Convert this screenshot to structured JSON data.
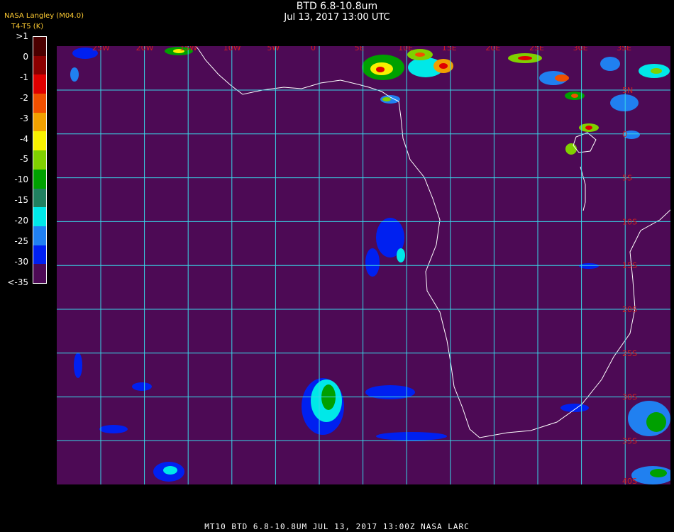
{
  "header": {
    "title": "BTD 6.8-10.8um",
    "subtitle": "Jul 13, 2017 13:00 UTC",
    "source": "NASA Langley (M04.0)",
    "units": "T4-T5 (K)"
  },
  "legend": {
    "items": [
      {
        "label": ">1",
        "color": "#4a0000"
      },
      {
        "label": "0",
        "color": "#8b0000"
      },
      {
        "label": "-1",
        "color": "#e00000"
      },
      {
        "label": "-2",
        "color": "#f05000"
      },
      {
        "label": "-3",
        "color": "#f0a000"
      },
      {
        "label": "-4",
        "color": "#f8f000"
      },
      {
        "label": "-5",
        "color": "#80d000"
      },
      {
        "label": "-10",
        "color": "#00a000"
      },
      {
        "label": "-15",
        "color": "#208060"
      },
      {
        "label": "-20",
        "color": "#00e8e8"
      },
      {
        "label": "-25",
        "color": "#2080f0"
      },
      {
        "label": "-30",
        "color": "#0020f0"
      },
      {
        "label": "<-35",
        "color": "#4d0a55"
      }
    ]
  },
  "map": {
    "background_color": "#4d0a55",
    "grid_color": "#38d8e8",
    "label_color": "#d02020",
    "lon_labels": [
      "25W",
      "20W",
      "15W",
      "10W",
      "5W",
      "0",
      "5E",
      "10E",
      "15E",
      "20E",
      "25E",
      "30E",
      "35E"
    ],
    "lat_labels": [
      "5N",
      "0",
      "5S",
      "10S",
      "15S",
      "20S",
      "25S",
      "30S",
      "35S",
      "40S"
    ]
  },
  "footer": {
    "text": "MT10   BTD 6.8-10.8UM   JUL 13, 2017 13:00Z   NASA LARC"
  }
}
